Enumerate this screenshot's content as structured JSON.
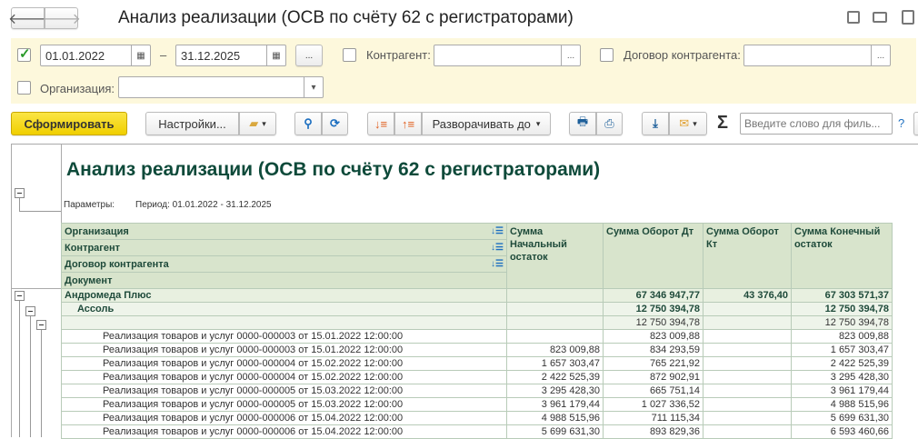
{
  "window": {
    "title": "Анализ реализации (ОСВ по счёту 62 с регистраторами)"
  },
  "filters": {
    "period_enabled": true,
    "date_from": "01.01.2022",
    "date_to": "31.12.2025",
    "dash": "–",
    "more": "...",
    "kontragent_label": "Контрагент:",
    "kontragent_value": "",
    "dogovor_label": "Договор контрагента:",
    "dogovor_value": "",
    "org_label": "Организация:",
    "org_value": ""
  },
  "toolbar": {
    "generate": "Сформировать",
    "settings": "Настройки...",
    "expand": "Разворачивать до",
    "search_placeholder": "Введите слово для филь...",
    "help": "?",
    "sigma": "Σ"
  },
  "report": {
    "title": "Анализ реализации (ОСВ по счёту 62 с регистраторами)",
    "params_label": "Параметры:",
    "params_value": "Период: 01.01.2022 - 31.12.2025",
    "group_headers": [
      "Организация",
      "Контрагент",
      "Договор контрагента",
      "Документ"
    ],
    "col_headers": [
      "Сумма Начальный остаток",
      "Сумма Оборот Дт",
      "Сумма Оборот Кт",
      "Сумма Конечный остаток"
    ],
    "org": {
      "name": "Андромеда Плюс",
      "start": "",
      "dt": "67 346 947,77",
      "kt": "43 376,40",
      "end": "67 303 571,37"
    },
    "kontr": {
      "name": "Ассоль",
      "start": "",
      "dt": "12 750 394,78",
      "kt": "",
      "end": "12 750 394,78"
    },
    "dogovor": {
      "name": "",
      "start": "",
      "dt": "12 750 394,78",
      "kt": "",
      "end": "12 750 394,78"
    },
    "rows": [
      {
        "doc": "Реализация товаров и услуг 0000-000003 от 15.01.2022 12:00:00",
        "start": "",
        "dt": "823 009,88",
        "kt": "",
        "end": "823 009,88"
      },
      {
        "doc": "Реализация товаров и услуг 0000-000003 от 15.01.2022 12:00:00",
        "start": "823 009,88",
        "dt": "834 293,59",
        "kt": "",
        "end": "1 657 303,47"
      },
      {
        "doc": "Реализация товаров и услуг 0000-000004 от 15.02.2022 12:00:00",
        "start": "1 657 303,47",
        "dt": "765 221,92",
        "kt": "",
        "end": "2 422 525,39"
      },
      {
        "doc": "Реализация товаров и услуг 0000-000004 от 15.02.2022 12:00:00",
        "start": "2 422 525,39",
        "dt": "872 902,91",
        "kt": "",
        "end": "3 295 428,30"
      },
      {
        "doc": "Реализация товаров и услуг 0000-000005 от 15.03.2022 12:00:00",
        "start": "3 295 428,30",
        "dt": "665 751,14",
        "kt": "",
        "end": "3 961 179,44"
      },
      {
        "doc": "Реализация товаров и услуг 0000-000005 от 15.03.2022 12:00:00",
        "start": "3 961 179,44",
        "dt": "1 027 336,52",
        "kt": "",
        "end": "4 988 515,96"
      },
      {
        "doc": "Реализация товаров и услуг 0000-000006 от 15.04.2022 12:00:00",
        "start": "4 988 515,96",
        "dt": "711 115,34",
        "kt": "",
        "end": "5 699 631,30"
      },
      {
        "doc": "Реализация товаров и услуг 0000-000006 от 15.04.2022 12:00:00",
        "start": "5 699 631,30",
        "dt": "893 829,36",
        "kt": "",
        "end": "6 593 460,66"
      }
    ]
  }
}
